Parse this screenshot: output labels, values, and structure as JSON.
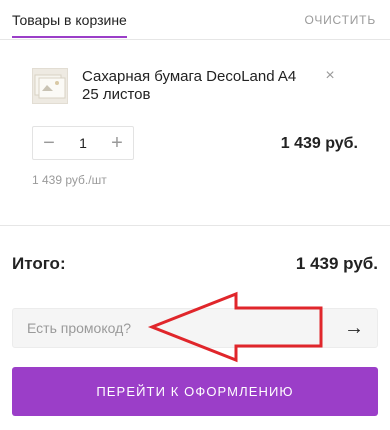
{
  "header": {
    "tab_label": "Товары в корзине",
    "clear_label": "ОЧИСТИТЬ"
  },
  "cart_items": [
    {
      "title": "Сахарная бумага DecoLand A4 25 листов",
      "quantity": "1",
      "line_total": "1 439 руб.",
      "unit_price": "1 439 руб./шт",
      "remove_symbol": "×",
      "minus_symbol": "−",
      "plus_symbol": "+"
    }
  ],
  "summary": {
    "total_label": "Итого:",
    "total_value": "1 439 руб."
  },
  "promo": {
    "placeholder": "Есть промокод?",
    "submit_symbol": "→"
  },
  "checkout": {
    "label": "ПЕРЕЙТИ К ОФОРМЛЕНИЮ"
  },
  "colors": {
    "accent": "#9b3ec8",
    "annotation_arrow": "#e0262b"
  }
}
